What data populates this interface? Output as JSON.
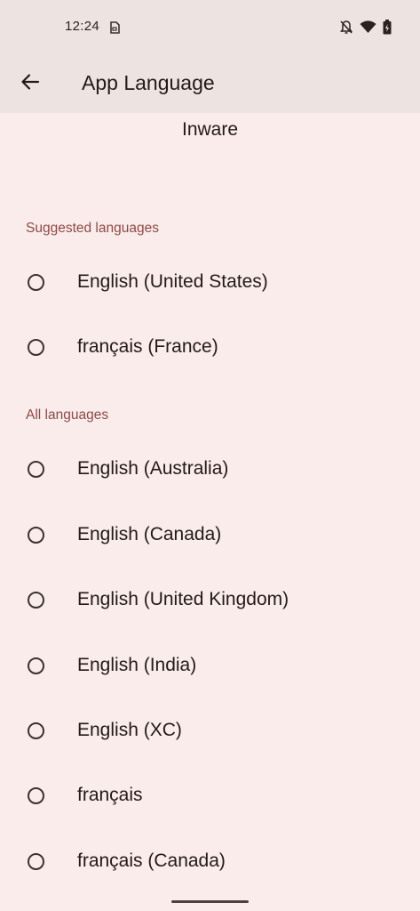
{
  "status_bar": {
    "time": "12:24",
    "icons": [
      "sim-card-icon",
      "notifications-off-icon",
      "wifi-icon",
      "battery-icon"
    ]
  },
  "app_bar": {
    "back_icon": "arrow-back-icon",
    "title": "App Language"
  },
  "app_name": "Inware",
  "sections": {
    "suggested": {
      "header": "Suggested languages",
      "items": [
        "English (United States)",
        "français (France)"
      ]
    },
    "all": {
      "header": "All languages",
      "items": [
        "English (Australia)",
        "English (Canada)",
        "English (United Kingdom)",
        "English (India)",
        "English (XC)",
        "français",
        "français (Canada)"
      ]
    }
  },
  "colors": {
    "background": "#f9ecea",
    "app_bar": "#ede4e2",
    "section_header": "#904a47",
    "text": "#231a19"
  }
}
